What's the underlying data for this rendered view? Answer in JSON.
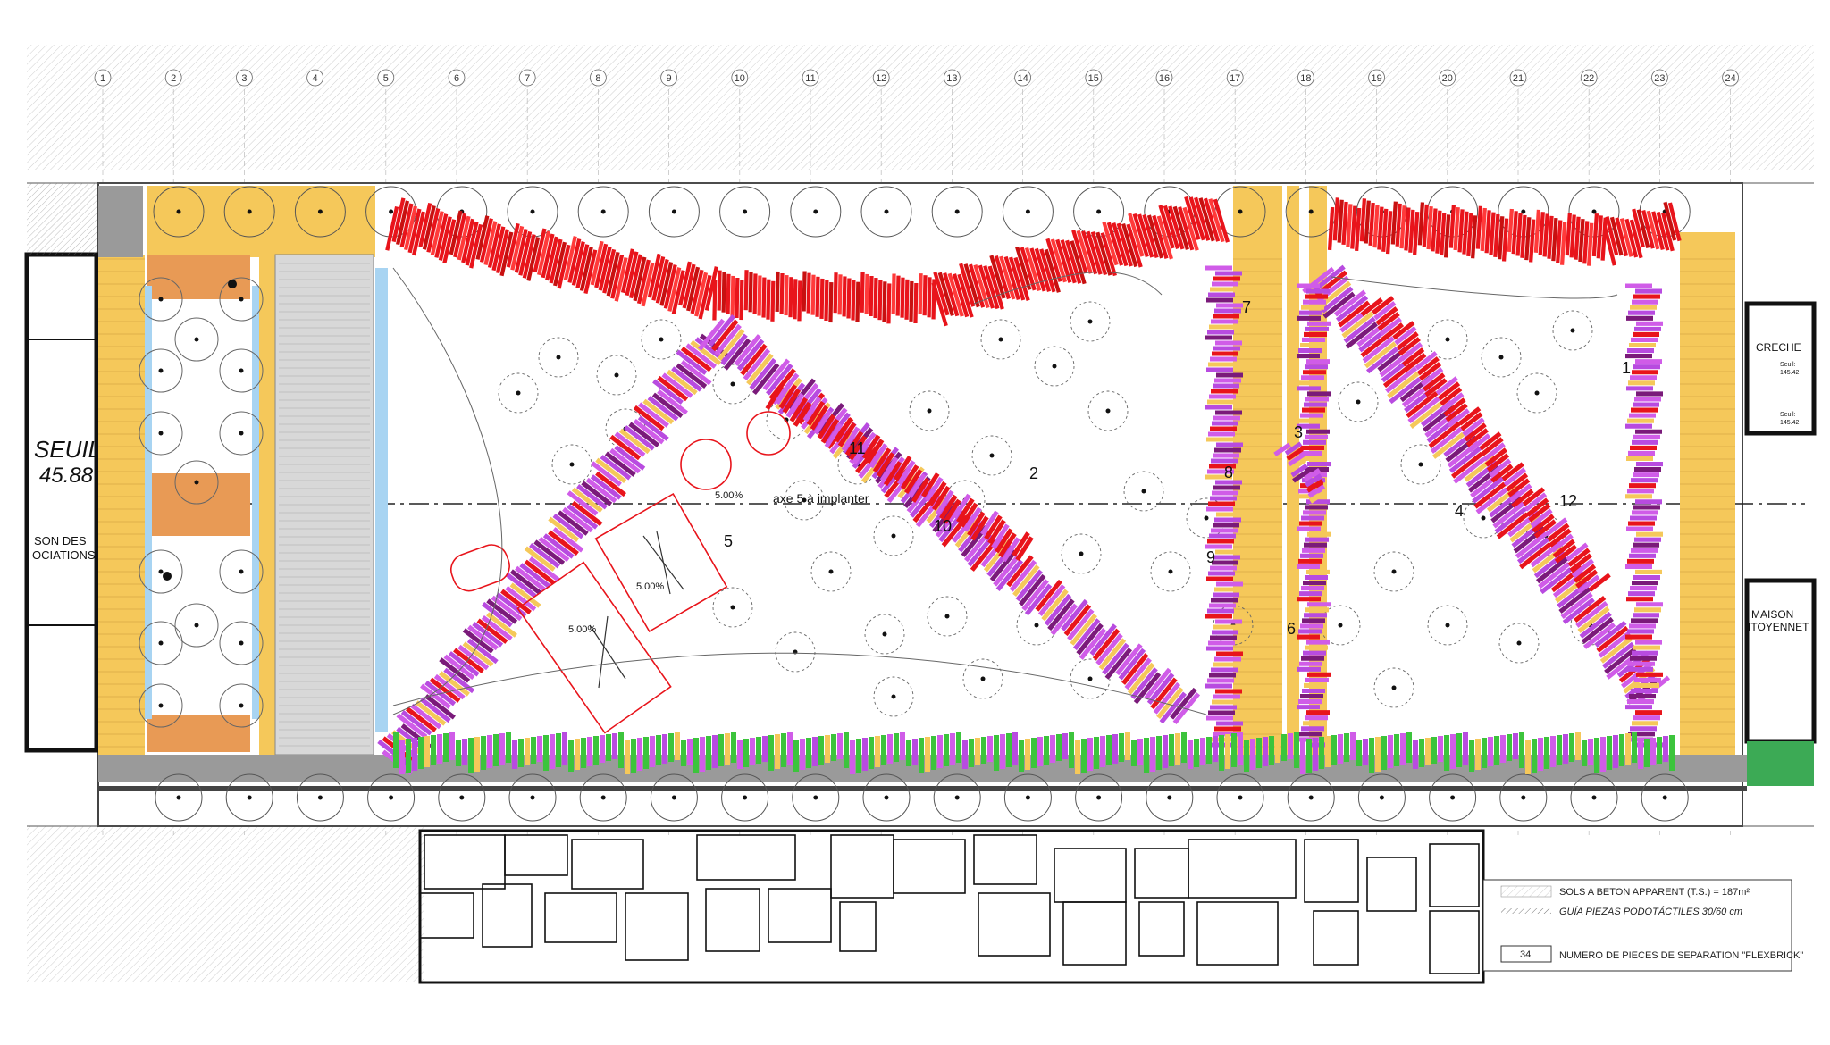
{
  "grid_numbers": [
    "1",
    "2",
    "3",
    "4",
    "5",
    "6",
    "7",
    "8",
    "9",
    "10",
    "11",
    "12",
    "13",
    "14",
    "15",
    "16",
    "17",
    "18",
    "19",
    "20",
    "21",
    "22",
    "23",
    "24"
  ],
  "buildings": {
    "left_seuil": "SEUIL",
    "left_value": "45.88",
    "left_name_1": "SON DES",
    "left_name_2": "OCIATIONS",
    "creche": "CRECHE",
    "creche_seuil_1": "Seuil:",
    "creche_seuil_1_value": "145.42",
    "creche_seuil_2": "Seuil:",
    "creche_seuil_2_value": "145.42",
    "maison_1": "MAISON",
    "maison_2": "ITOYENNET"
  },
  "annotations": {
    "axis_label": "axe 5 à implanter",
    "slope_1": "5.00%",
    "slope_2": "5.00%",
    "slope_3": "5.00%"
  },
  "band_numbers": [
    "1",
    "2",
    "3",
    "4",
    "5",
    "6",
    "7",
    "8",
    "9",
    "10",
    "11",
    "12"
  ],
  "legend": {
    "row1": "SOLS A BETON APPARENT (T.S.) = 187m²",
    "row2": "GUÍA PIEZAS PODOTÁCTILES 30/60 cm",
    "row3_num": "34",
    "row3": "NUMERO DE PIECES DE SEPARATION \"FLEXBRICK\""
  },
  "colors": {
    "red": "#e8141b",
    "magenta": "#d05ce8",
    "violet": "#b84be0",
    "yellow": "#f5c85a",
    "green": "#3cc43c",
    "grey": "#9a9a9a",
    "lightblue": "#a8d4f2",
    "orange": "#e89a55",
    "cyan": "#28d6c8"
  }
}
